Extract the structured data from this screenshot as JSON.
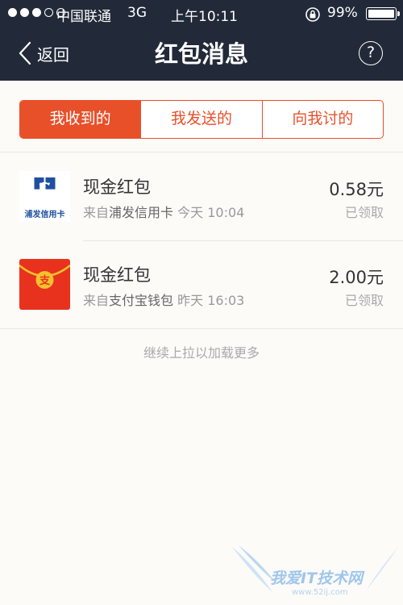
{
  "status_bar": {
    "carrier": "中国联通",
    "network": "3G",
    "time": "上午10:11",
    "battery_pct": "99%",
    "battery_level": 0.99
  },
  "nav": {
    "back_label": "返回",
    "title": "红包消息",
    "help_label": "?"
  },
  "tabs": [
    {
      "label": "我收到的",
      "active": true
    },
    {
      "label": "我发送的",
      "active": false
    },
    {
      "label": "向我讨的",
      "active": false
    }
  ],
  "items": [
    {
      "title": "现金红包",
      "from_prefix": "来自",
      "sender": "浦发信用卡",
      "time": "今天 10:04",
      "amount": "0.58元",
      "status": "已领取",
      "icon": "spdb-logo-icon",
      "icon_label": "浦发信用卡"
    },
    {
      "title": "现金红包",
      "from_prefix": "来自",
      "sender": "支付宝钱包",
      "time": "昨天 16:03",
      "amount": "2.00元",
      "status": "已领取",
      "icon": "alipay-red-envelope-icon",
      "icon_label": "支"
    }
  ],
  "load_more": "继续上拉以加载更多",
  "watermark": {
    "text": "我爱IT技术网",
    "url": "www.52ij.com"
  },
  "colors": {
    "nav_bg": "#222a39",
    "accent": "#e8502a",
    "envelope_red": "#e8321d",
    "envelope_gold": "#f5c12e",
    "spdb_blue": "#1f4fa0"
  }
}
